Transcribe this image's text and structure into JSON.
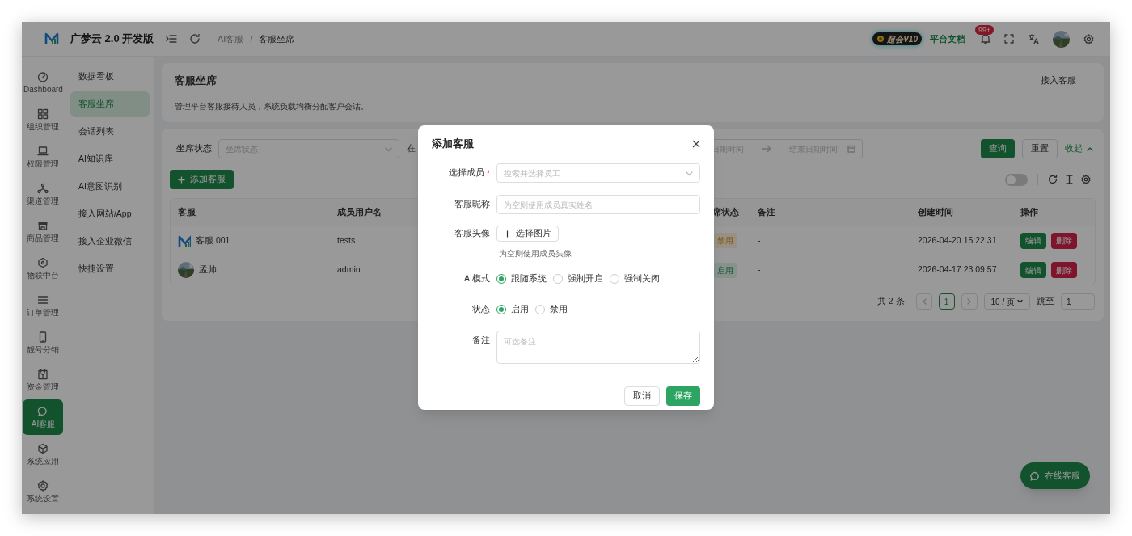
{
  "app": {
    "title": "广梦云 2.0 开发版"
  },
  "breadcrumb": {
    "items": [
      "AI客服",
      "客服坐席"
    ],
    "separator": "/"
  },
  "header_actions": {
    "badge": "超会V10",
    "docs_link": "平台文档",
    "notification_count": "99+"
  },
  "rail": [
    {
      "label": "Dashboard",
      "selected": false
    },
    {
      "label": "组织管理",
      "selected": false
    },
    {
      "label": "权限管理",
      "selected": false
    },
    {
      "label": "渠道管理",
      "selected": false
    },
    {
      "label": "商品管理",
      "selected": false
    },
    {
      "label": "物联中台",
      "selected": false
    },
    {
      "label": "订单管理",
      "selected": false
    },
    {
      "label": "靓号分销",
      "selected": false
    },
    {
      "label": "资金管理",
      "selected": false
    },
    {
      "label": "AI客服",
      "selected": true
    },
    {
      "label": "系统应用",
      "selected": false
    },
    {
      "label": "系统设置",
      "selected": false
    }
  ],
  "submenu": [
    {
      "label": "数据看板",
      "selected": false
    },
    {
      "label": "客服坐席",
      "selected": true
    },
    {
      "label": "会话列表",
      "selected": false
    },
    {
      "label": "AI知识库",
      "selected": false
    },
    {
      "label": "AI意图识别",
      "selected": false
    },
    {
      "label": "接入网站/App",
      "selected": false
    },
    {
      "label": "接入企业微信",
      "selected": false
    },
    {
      "label": "快捷设置",
      "selected": false
    }
  ],
  "page": {
    "title": "客服坐席",
    "description": "管理平台客服接待人员，系统负载均衡分配客户会话。",
    "action": "接入客服"
  },
  "filters": {
    "status_label": "坐席状态",
    "status_placeholder": "坐席状态",
    "time_label": "在",
    "date_start_placeholder": "日期时间",
    "date_end_placeholder": "结束日期时间",
    "query": "查询",
    "reset": "重置",
    "collapse": "收起"
  },
  "toolbar": {
    "add_button": "添加客服",
    "toggle_on": false
  },
  "table": {
    "columns": [
      "客服",
      "成员用户名",
      "席状态",
      "备注",
      "创建时间",
      "操作"
    ],
    "rows": [
      {
        "avatar": {
          "kind": "logo"
        },
        "name": "客服 001",
        "username": "tests",
        "status": {
          "label": "禁用",
          "kind": "disabled"
        },
        "remark": "-",
        "created": "2026-04-20 15:22:31",
        "actions": [
          "编辑",
          "删除"
        ]
      },
      {
        "avatar": {
          "kind": "picture"
        },
        "name": "孟帅",
        "username": "admin",
        "status": {
          "label": "启用",
          "kind": "enabled"
        },
        "remark": "-",
        "created": "2026-04-17 23:09:57",
        "actions": [
          "编辑",
          "删除"
        ]
      }
    ]
  },
  "pagination": {
    "total": "共 2 条",
    "pages": [
      {
        "label": "1",
        "selected": true
      }
    ],
    "page_size": "10 / 页",
    "jump_label": "跳至",
    "jump_value": "1"
  },
  "float_button": "在线客服",
  "dialog": {
    "title": "添加客服",
    "fields": [
      {
        "kind": "select",
        "label": "选择成员",
        "required_mark": "*",
        "placeholder": "搜索并选择员工"
      },
      {
        "kind": "input",
        "label": "客服昵称",
        "placeholder": "为空则使用成员真实姓名"
      },
      {
        "kind": "upload",
        "label": "客服头像",
        "button": "选择图片",
        "hint": "为空则使用成员头像"
      },
      {
        "kind": "radio",
        "label": "AI模式",
        "options": [
          {
            "label": "跟随系统",
            "selected": true
          },
          {
            "label": "强制开启",
            "selected": false
          },
          {
            "label": "强制关闭",
            "selected": false
          }
        ]
      },
      {
        "kind": "radio",
        "label": "状态",
        "options": [
          {
            "label": "启用",
            "selected": true
          },
          {
            "label": "禁用",
            "selected": false
          }
        ]
      },
      {
        "kind": "textarea",
        "label": "备注",
        "placeholder": "可选备注"
      }
    ],
    "cancel": "取消",
    "save": "保存"
  }
}
